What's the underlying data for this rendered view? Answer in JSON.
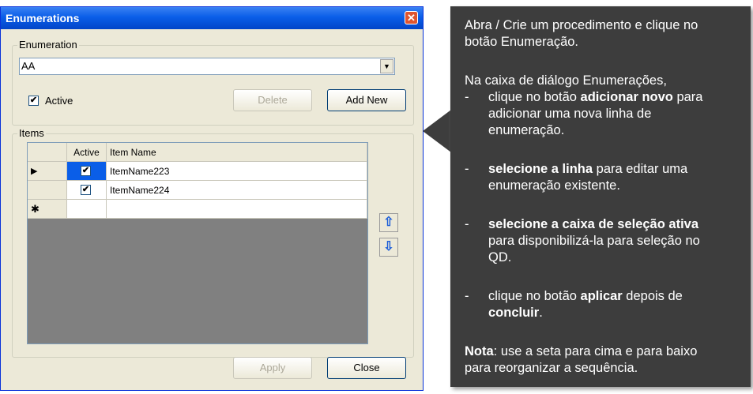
{
  "dialog": {
    "title": "Enumerations",
    "close_glyph": "✕",
    "enumeration_group_label": "Enumeration",
    "enumeration_value": "AA",
    "dropdown_glyph": "▼",
    "active_label": "Active",
    "active_checked": true,
    "delete_label": "Delete",
    "add_new_label": "Add New",
    "items_group_label": "Items",
    "grid": {
      "columns": [
        "Active",
        "Item Name"
      ],
      "rows": [
        {
          "indicator": "▶",
          "active": true,
          "name": "ItemName223"
        },
        {
          "indicator": "",
          "active": true,
          "name": "ItemName224"
        },
        {
          "indicator": "✱",
          "active": false,
          "name": ""
        }
      ]
    },
    "move_up_glyph": "⇧",
    "move_down_glyph": "⇩",
    "apply_label": "Apply",
    "close_label": "Close"
  },
  "callout": {
    "intro_line1": "Abra / Crie um procedimento e clique no",
    "intro_line2": "botão Enumeração.",
    "para_line": "Na caixa de diálogo Enumerações,",
    "dash": "-",
    "b1_pre": "clique no botão ",
    "b1_bold": "adicionar novo",
    "b1_post": " para",
    "b1_l2": "adicionar uma nova linha de",
    "b1_l3": "enumeração.",
    "b2_bold": "selecione a linha",
    "b2_post": " para editar uma",
    "b2_l2": "enumeração existente.",
    "b3_bold": "selecione a caixa de seleção ativa",
    "b3_l2": "para disponibilizá-la para seleção no",
    "b3_l3": "QD.",
    "b4_pre": "clique no botão ",
    "b4_bold": "aplicar",
    "b4_post": " depois de",
    "b4_l2_bold": "concluir",
    "b4_l2_post": ".",
    "note_bold": "Nota",
    "note_post": ": use a seta para cima e para baixo",
    "note_l2": "para reorganizar a sequência."
  }
}
